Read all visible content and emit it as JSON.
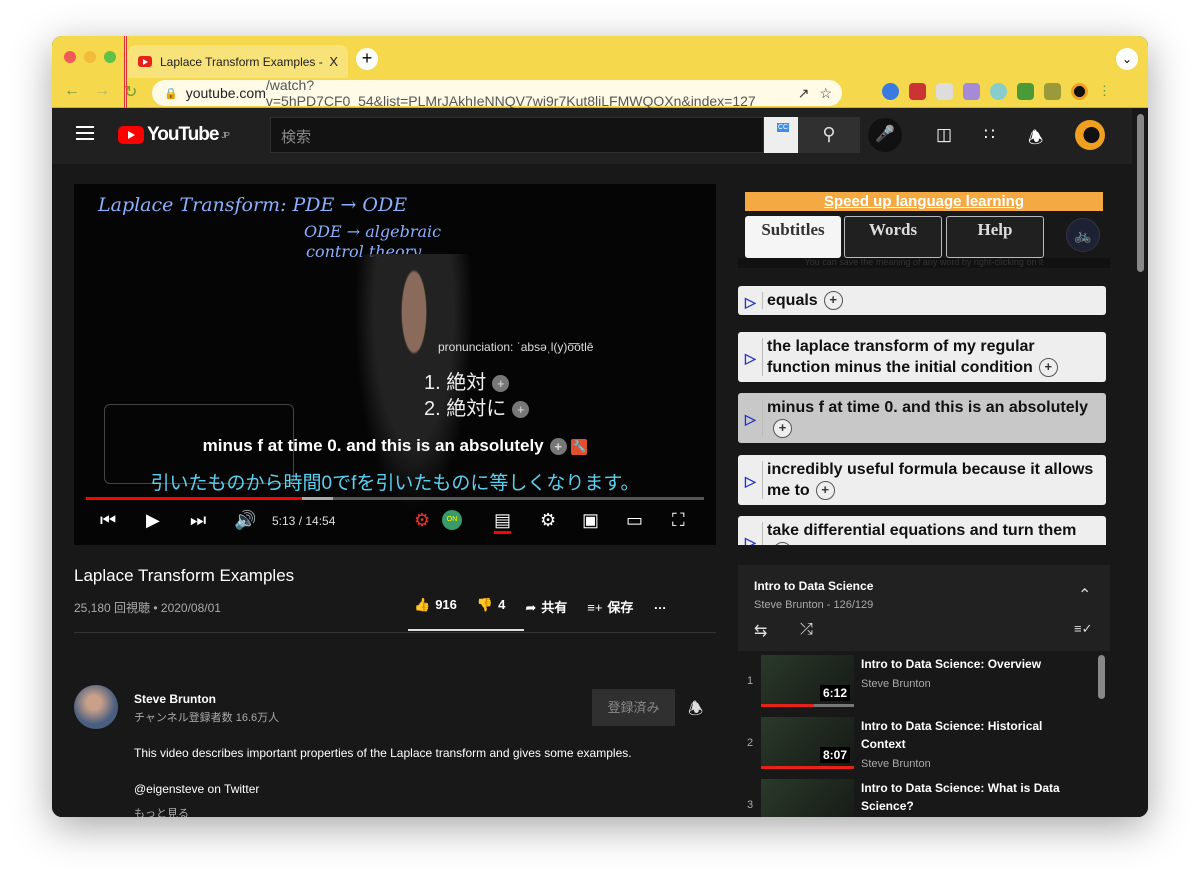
{
  "browser": {
    "tab_title": "Laplace Transform Examples -",
    "tab_close": "X",
    "new_tab": "+",
    "url_domain": "youtube.com",
    "url_path": "/watch?v=5hPD7CF0_54&list=PLMrJAkhIeNNQV7wi9r7Kut8liLFMWQOXn&index=127"
  },
  "masthead": {
    "logo": "YouTube",
    "region": "JP",
    "search_placeholder": "検索"
  },
  "video": {
    "board_lines": [
      "Laplace Transform:  PDE → ODE",
      "ODE → algebraic",
      "control theory"
    ],
    "pronunciation": "pronunciation: ˈabsəˌl(y)o͞otlē",
    "translations": [
      "1.      絶対",
      "2.    絶対に"
    ],
    "subtitle_en": "minus f at time 0. and this is an absolutely",
    "subtitle_ja": "引いたものから時間0でfを引いたものに等しくなります。",
    "current_time": "5:13",
    "duration": "14:54",
    "time_display": "5:13 / 14:54",
    "progress_percent": 35,
    "buffered_percent": 40,
    "title": "Laplace Transform Examples",
    "views_date": "25,180 回視聴 • 2020/08/01",
    "likes": "916",
    "dislikes": "4",
    "share": "共有",
    "save": "保存",
    "more": "…"
  },
  "channel": {
    "name": "Steve Brunton",
    "subscribers": "チャンネル登録者数 16.6万人",
    "subscribed_label": "登録済み",
    "description": "This video describes important properties of the Laplace transform and gives some examples.",
    "twitter": "@eigensteve on Twitter",
    "show_more": "もっと見る"
  },
  "extension": {
    "banner": "Speed up language learning",
    "tabs": [
      "Subtitles",
      "Words",
      "Help"
    ],
    "hint": "You can save the meaning of any word by right-clicking on it",
    "cues": [
      "equals",
      "the laplace transform of my regular function minus the initial condition",
      "minus f at time 0. and this is an absolutely",
      "incredibly useful formula because it allows me to",
      "take differential equations and turn them"
    ],
    "current_cue": 2,
    "accent": "#f4a942"
  },
  "playlist": {
    "title": "Intro to Data Science",
    "subtitle": "Steve Brunton - 126/129",
    "items": [
      {
        "index": "1",
        "title": "Intro to Data Science: Overview",
        "author": "Steve Brunton",
        "duration": "6:12",
        "watched_percent": 57
      },
      {
        "index": "2",
        "title": "Intro to Data Science: Historical Context",
        "author": "Steve Brunton",
        "duration": "8:07",
        "watched_percent": 100
      },
      {
        "index": "3",
        "title": "Intro to Data Science: What is Data Science?",
        "author": "",
        "duration": "",
        "watched_percent": 0
      }
    ]
  }
}
